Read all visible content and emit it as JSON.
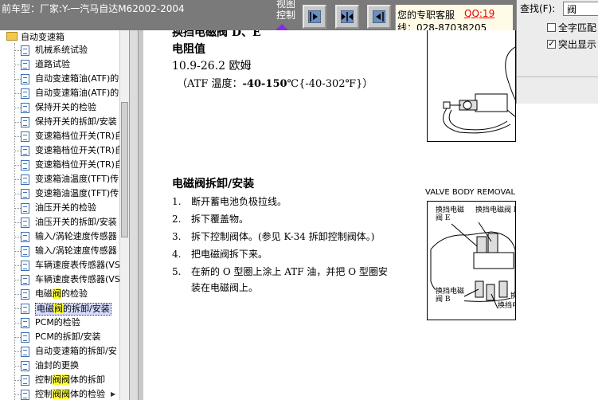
{
  "topbar": {
    "car_model": "前车型：厂家:Y-一汽马自达M62002-2004",
    "view_control": "视图控制",
    "buttons": {
      "next_icon": "next-page-icon",
      "fit_icon": "fit-page-icon",
      "prev_icon": "prev-page-icon"
    },
    "service_label": "您的专职客服",
    "qq_link": "QQ:19",
    "phone_line": "线：028-87038205"
  },
  "find": {
    "label": "查找(F):",
    "value": "阀",
    "option_whole": "全字匹配",
    "option_whole_checked": false,
    "option_highlight": "突出显示",
    "option_highlight_checked": true
  },
  "tree": {
    "root_label": "自动变速箱",
    "items": [
      {
        "pre": "机械系统试验",
        "hit": "",
        "post": ""
      },
      {
        "pre": "道路试验",
        "hit": "",
        "post": ""
      },
      {
        "pre": "自动变速箱油(ATF)的",
        "hit": "",
        "post": ""
      },
      {
        "pre": "自动变速箱油(ATF)的",
        "hit": "",
        "post": ""
      },
      {
        "pre": "保持开关的检验",
        "hit": "",
        "post": ""
      },
      {
        "pre": "保持开关的拆卸/安装",
        "hit": "",
        "post": ""
      },
      {
        "pre": "变速箱档位开关(TR)自",
        "hit": "",
        "post": ""
      },
      {
        "pre": "变速箱档位开关(TR)自",
        "hit": "",
        "post": ""
      },
      {
        "pre": "变速箱档位开关(TR)自",
        "hit": "",
        "post": ""
      },
      {
        "pre": "变速箱油温度(TFT)传",
        "hit": "",
        "post": ""
      },
      {
        "pre": "变速箱油温度(TFT)传",
        "hit": "",
        "post": ""
      },
      {
        "pre": "油压开关的检验",
        "hit": "",
        "post": ""
      },
      {
        "pre": "油压开关的拆卸/安装",
        "hit": "",
        "post": ""
      },
      {
        "pre": "输入/涡轮速度传感器",
        "hit": "",
        "post": ""
      },
      {
        "pre": "输入/涡轮速度传感器",
        "hit": "",
        "post": ""
      },
      {
        "pre": "车辆速度表传感器(VS",
        "hit": "",
        "post": ""
      },
      {
        "pre": "车辆速度表传感器(VS",
        "hit": "",
        "post": ""
      },
      {
        "pre": "电磁",
        "hit": "阀",
        "post": "的检验"
      },
      {
        "pre": "电磁",
        "hit": "阀",
        "post": "的拆卸/安装"
      },
      {
        "pre": "PCM的检验",
        "hit": "",
        "post": ""
      },
      {
        "pre": "PCM的拆卸/安装",
        "hit": "",
        "post": ""
      },
      {
        "pre": "自动变速箱的拆卸/安",
        "hit": "",
        "post": ""
      },
      {
        "pre": "油封的更换",
        "hit": "",
        "post": ""
      },
      {
        "pre": "控制",
        "hit": "阀阀",
        "post": "体的拆卸"
      },
      {
        "pre": "控制",
        "hit": "阀阀",
        "post": "体的检验"
      }
    ]
  },
  "doc": {
    "cut_heading": "换挡电磁阀 D、E",
    "resist_title": "电阻值",
    "resist_value": "10.9-26.2 欧姆",
    "resist_temp_open": "（ATF 温度：",
    "resist_temp_bold": "-40-150",
    "resist_temp_close": "℃{-40-302℉}）",
    "removal_title": "电磁阀拆卸/安装",
    "steps": [
      {
        "num": "1.",
        "text": "断开蓄电池负极拉线。"
      },
      {
        "num": "2.",
        "text": "拆下覆盖物。"
      },
      {
        "num": "3.",
        "text": "拆下控制阀体。(参见 K-34 拆卸控制阀体。)"
      },
      {
        "num": "4.",
        "text": "把电磁阀拆下来。"
      },
      {
        "num": "5.",
        "text": "在新的 O 型圈上涂上 ATF 油，并把 O 型圈安"
      }
    ],
    "step5_cont": "装在电磁阀上。",
    "figure_caption": "VALVE BODY REMOVAL.)",
    "figure_labels": {
      "e": "换挡电磁\n阀 E",
      "d": "换挡电磁阀 D",
      "b": "换挡电磁\n阀 B",
      "c": "换挡电磁阀 C",
      "edge": "换"
    }
  }
}
